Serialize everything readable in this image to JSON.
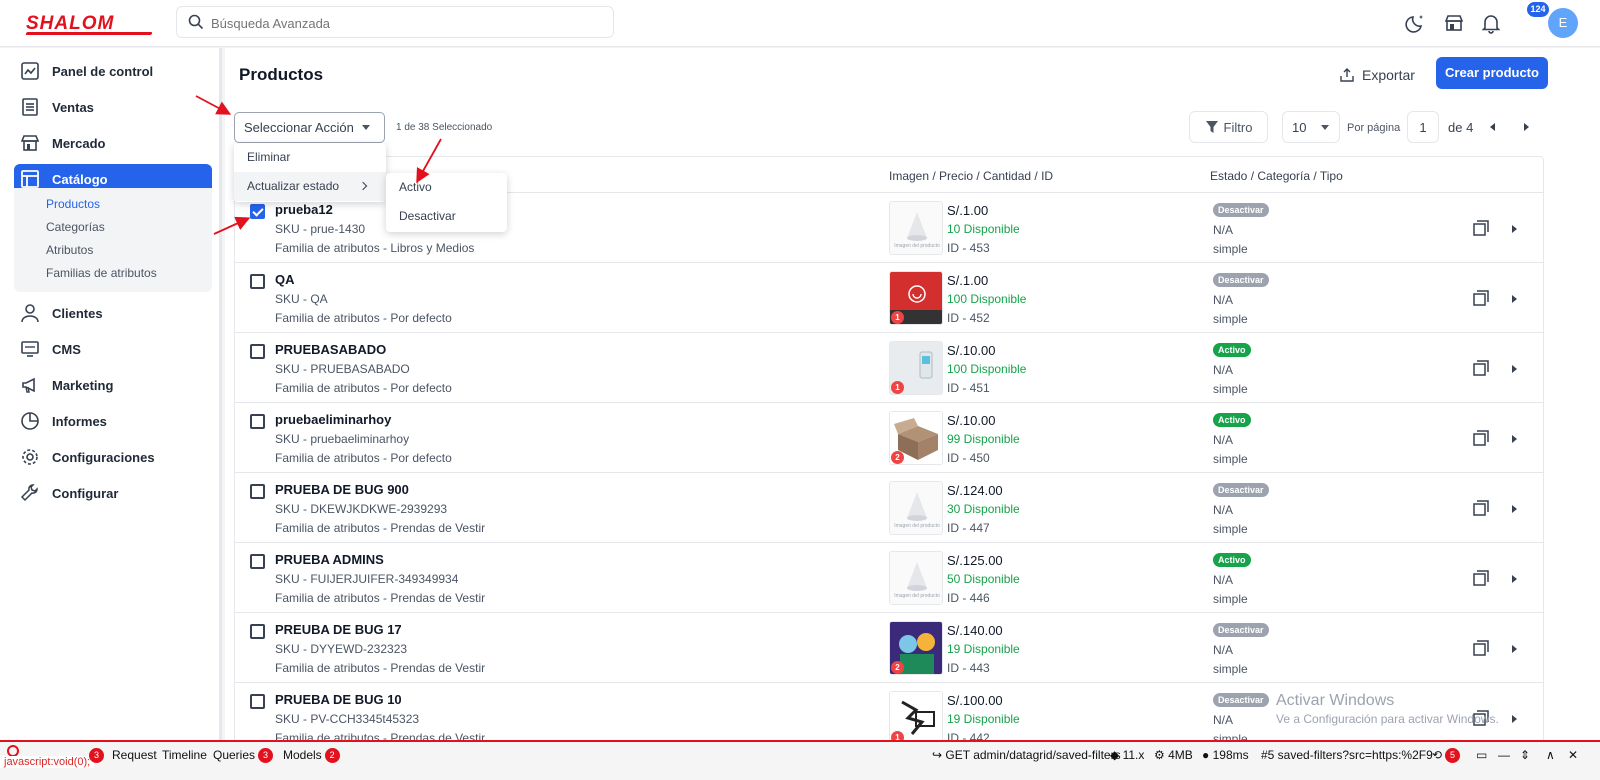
{
  "header": {
    "logo": "SHALOM",
    "search_placeholder": "Búsqueda Avanzada",
    "notification_count": "124",
    "avatar_initial": "E"
  },
  "sidebar": {
    "items": [
      {
        "label": "Panel de control",
        "icon": "dashboard-icon"
      },
      {
        "label": "Ventas",
        "icon": "sales-icon"
      },
      {
        "label": "Mercado",
        "icon": "store-icon"
      },
      {
        "label": "Catálogo",
        "icon": "catalog-icon"
      },
      {
        "label": "Clientes",
        "icon": "user-icon"
      },
      {
        "label": "CMS",
        "icon": "cms-icon"
      },
      {
        "label": "Marketing",
        "icon": "megaphone-icon"
      },
      {
        "label": "Informes",
        "icon": "chart-pie-icon"
      },
      {
        "label": "Configuraciones",
        "icon": "gear-icon"
      },
      {
        "label": "Configurar",
        "icon": "wrench-icon"
      }
    ],
    "catalog_subitems": [
      "Productos",
      "Categorías",
      "Atributos",
      "Familias de atributos"
    ]
  },
  "main": {
    "title": "Productos",
    "export_label": "Exportar",
    "create_label": "Crear producto",
    "action_select": "Seleccionar Acción",
    "selected_count": "1 de 38 Seleccionado",
    "filter_label": "Filtro",
    "per_page_value": "10",
    "per_page_label": "Por página",
    "page_current": "1",
    "page_of": "de 4",
    "columns": [
      "Imagen / Precio / Cantidad / ID",
      "Estado / Categoría / Tipo"
    ]
  },
  "menu": {
    "items": [
      "Eliminar",
      "Actualizar estado"
    ],
    "submenu": [
      "Activo",
      "Desactivar"
    ]
  },
  "rows": [
    {
      "name": "prueba12",
      "sku": "SKU - prue-1430",
      "family": "Familia de atributos - Libros y Medios",
      "price": "S/.1.00",
      "qty": "10 Disponible",
      "id": "ID - 453",
      "status": "Desactivar",
      "active": false,
      "category": "N/A",
      "type": "simple",
      "checked": true,
      "image": "placeholder",
      "img_count": ""
    },
    {
      "name": "QA",
      "sku": "SKU - QA",
      "family": "Familia de atributos - Por defecto",
      "price": "S/.1.00",
      "qty": "100 Disponible",
      "id": "ID - 452",
      "status": "Desactivar",
      "active": false,
      "category": "N/A",
      "type": "simple",
      "checked": false,
      "image": "red-box",
      "img_count": "1"
    },
    {
      "name": "PRUEBASABADO",
      "sku": "SKU - PRUEBASABADO",
      "family": "Familia de atributos - Por defecto",
      "price": "S/.10.00",
      "qty": "100 Disponible",
      "id": "ID - 451",
      "status": "Activo",
      "active": true,
      "category": "N/A",
      "type": "simple",
      "checked": false,
      "image": "device",
      "img_count": "1"
    },
    {
      "name": "pruebaeliminarhoy",
      "sku": "SKU - pruebaeliminarhoy",
      "family": "Familia de atributos - Por defecto",
      "price": "S/.10.00",
      "qty": "99 Disponible",
      "id": "ID - 450",
      "status": "Activo",
      "active": true,
      "category": "N/A",
      "type": "simple",
      "checked": false,
      "image": "box",
      "img_count": "2"
    },
    {
      "name": "PRUEBA DE BUG 900",
      "sku": "SKU - DKEWJKDKWE-2939293",
      "family": "Familia de atributos - Prendas de Vestir",
      "price": "S/.124.00",
      "qty": "30 Disponible",
      "id": "ID - 447",
      "status": "Desactivar",
      "active": false,
      "category": "N/A",
      "type": "simple",
      "checked": false,
      "image": "placeholder",
      "img_count": ""
    },
    {
      "name": "PRUEBA ADMINS",
      "sku": "SKU - FUIJERJUIFER-349349934",
      "family": "Familia de atributos - Prendas de Vestir",
      "price": "S/.125.00",
      "qty": "50 Disponible",
      "id": "ID - 446",
      "status": "Activo",
      "active": true,
      "category": "N/A",
      "type": "simple",
      "checked": false,
      "image": "placeholder",
      "img_count": ""
    },
    {
      "name": "PREUBA DE BUG 17",
      "sku": "SKU - DYYEWD-232323",
      "family": "Familia de atributos - Prendas de Vestir",
      "price": "S/.140.00",
      "qty": "19 Disponible",
      "id": "ID - 443",
      "status": "Desactivar",
      "active": false,
      "category": "N/A",
      "type": "simple",
      "checked": false,
      "image": "cartoon",
      "img_count": "2"
    },
    {
      "name": "PRUEBA DE BUG 10",
      "sku": "SKU - PV-CCH3345t45323",
      "family": "Familia de atributos - Prendas de Vestir",
      "price": "S/.100.00",
      "qty": "19 Disponible",
      "id": "ID - 442",
      "status": "Desactivar",
      "active": false,
      "category": "N/A",
      "type": "simple",
      "checked": false,
      "image": "logo",
      "img_count": "1"
    }
  ],
  "placeholder_caption": "Imagen del producto",
  "watermark": {
    "title": "Activar Windows",
    "subtitle": "Ve a Configuración para activar Windows."
  },
  "debugbar": {
    "url": "javascript:void(0);",
    "errors": "3",
    "request": "Request",
    "timeline": "Timeline",
    "queries": "Queries",
    "queries_count": "3",
    "models": "Models",
    "models_count": "2",
    "route": "GET admin/datagrid/saved-filters",
    "version": "11.x",
    "memory": "4MB",
    "time": "198ms",
    "request_id": "#5 saved-filters?src=https:%2F9",
    "history_count": "5"
  },
  "colors": {
    "accent": "#2563eb",
    "brand": "#e3101e",
    "success": "#16a34a",
    "muted": "#9ca3af"
  }
}
